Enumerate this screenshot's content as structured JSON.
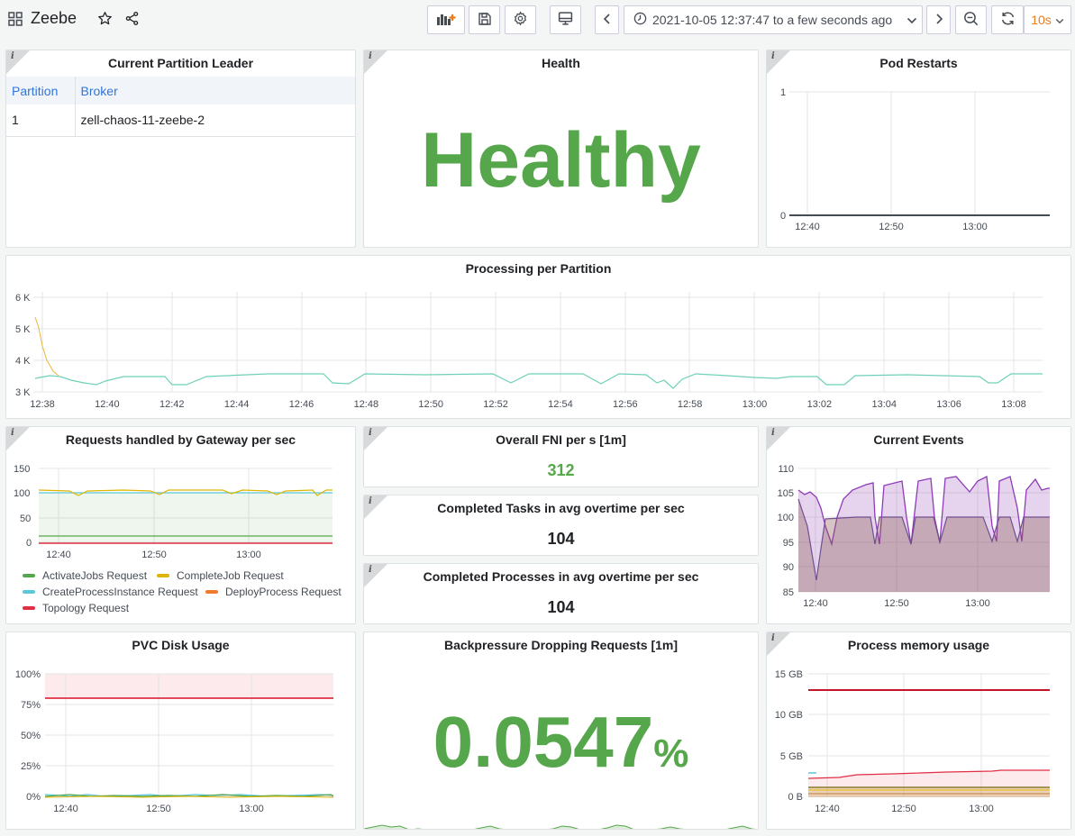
{
  "dashboard": {
    "title": "Zeebe"
  },
  "toolbar": {
    "time_range": "2021-10-05 12:37:47 to a few seconds ago",
    "refresh_interval": "10s"
  },
  "colors": {
    "healthy": "#56a64b",
    "accent": "#eb7b18",
    "link": "#3274d9"
  },
  "panels": {
    "partition_leader": {
      "title": "Current Partition Leader",
      "columns": [
        "Partition",
        "Broker"
      ],
      "rows": [
        [
          "1",
          "zell-chaos-11-zeebe-2"
        ]
      ]
    },
    "health": {
      "title": "Health",
      "value": "Healthy"
    },
    "pod_restarts": {
      "title": "Pod Restarts",
      "y_ticks": [
        "1",
        "0"
      ],
      "x_ticks": [
        "12:40",
        "12:50",
        "13:00"
      ]
    },
    "processing": {
      "title": "Processing per Partition",
      "y_ticks": [
        "6 K",
        "5 K",
        "4 K",
        "3 K"
      ],
      "x_ticks": [
        "12:38",
        "12:40",
        "12:42",
        "12:44",
        "12:46",
        "12:48",
        "12:50",
        "12:52",
        "12:54",
        "12:56",
        "12:58",
        "13:00",
        "13:02",
        "13:04",
        "13:06",
        "13:08"
      ]
    },
    "gateway": {
      "title": "Requests handled by Gateway per sec",
      "y_ticks": [
        "150",
        "100",
        "50",
        "0"
      ],
      "x_ticks": [
        "12:40",
        "12:50",
        "13:00"
      ],
      "legend": [
        {
          "name": "ActivateJobs Request",
          "color": "#56a64b"
        },
        {
          "name": "CompleteJob Request",
          "color": "#e0b400"
        },
        {
          "name": "CreateProcessInstance Request",
          "color": "#5ac8d8"
        },
        {
          "name": "DeployProcess Request",
          "color": "#f07b2a"
        },
        {
          "name": "Topology Request",
          "color": "#e02f44"
        }
      ]
    },
    "fni": {
      "title": "Overall FNI per s [1m]",
      "value": "312"
    },
    "completed_tasks": {
      "title": "Completed Tasks in avg overtime per sec",
      "value": "104"
    },
    "completed_processes": {
      "title": "Completed Processes in avg overtime per sec",
      "value": "104"
    },
    "current_events": {
      "title": "Current Events",
      "y_ticks": [
        "110",
        "105",
        "100",
        "95",
        "90",
        "85"
      ],
      "x_ticks": [
        "12:40",
        "12:50",
        "13:00"
      ]
    },
    "pvc": {
      "title": "PVC Disk Usage",
      "y_ticks": [
        "100%",
        "75%",
        "50%",
        "25%",
        "0%"
      ],
      "x_ticks": [
        "12:40",
        "12:50",
        "13:00"
      ]
    },
    "backpressure": {
      "title": "Backpressure Dropping Requests [1m]",
      "value": "0.0547",
      "unit": "%"
    },
    "memory": {
      "title": "Process memory usage",
      "y_ticks": [
        "15 GB",
        "10 GB",
        "5 GB",
        "0 B"
      ],
      "x_ticks": [
        "12:40",
        "12:50",
        "13:00"
      ]
    }
  }
}
